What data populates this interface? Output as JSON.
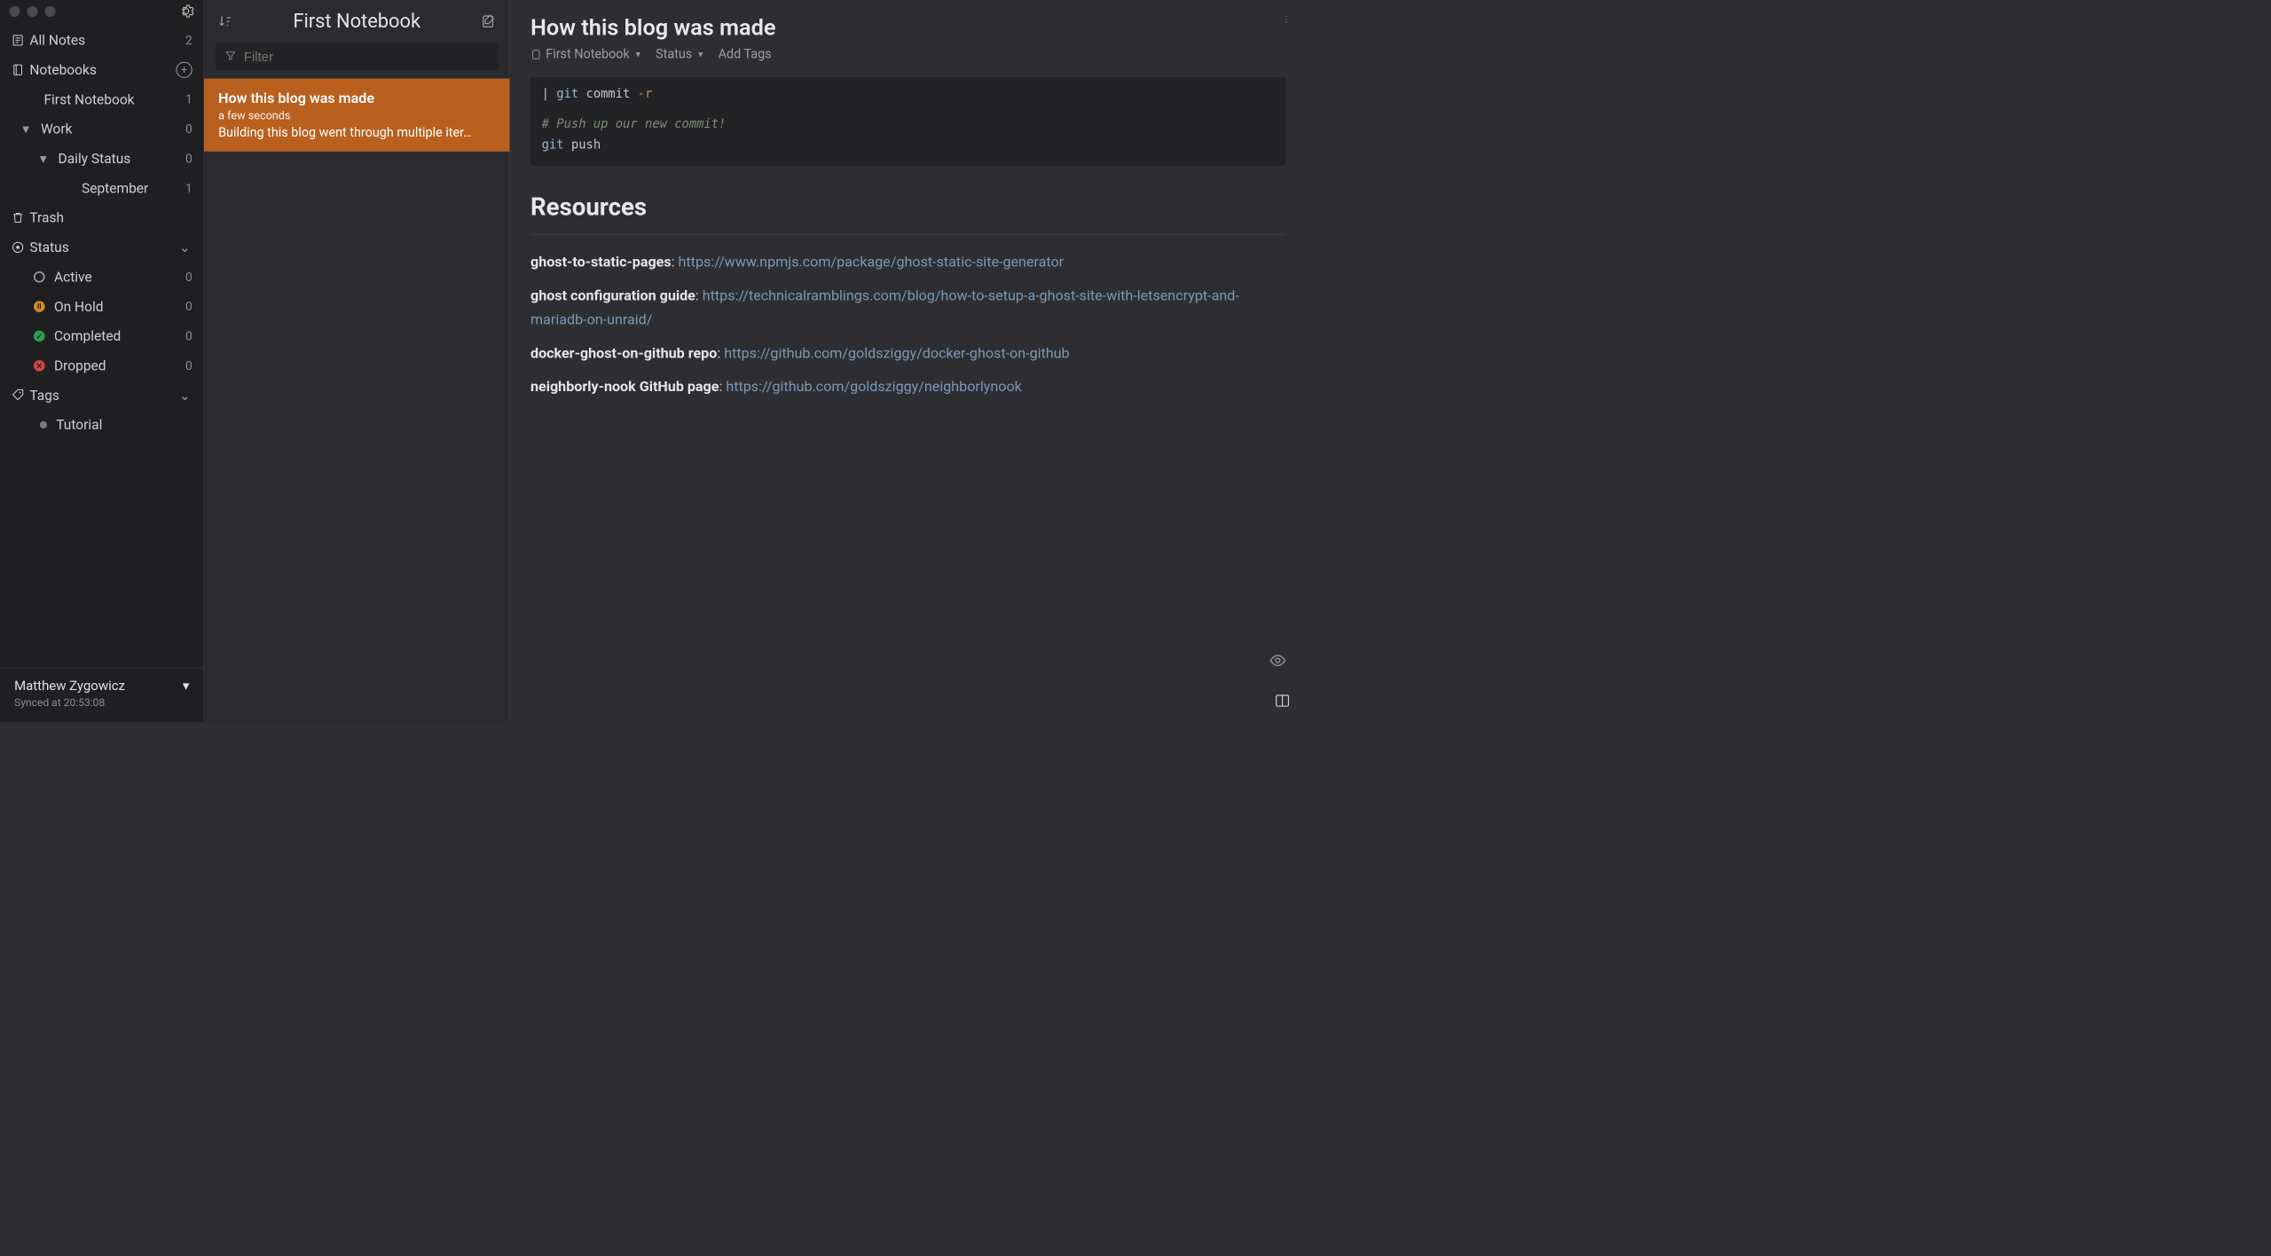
{
  "colors": {
    "accent": "#b9601f",
    "link": "#7a98b8",
    "bg": "#2e2e32"
  },
  "sidebar": {
    "all_notes": {
      "label": "All Notes",
      "count": "2"
    },
    "notebooks": {
      "label": "Notebooks"
    },
    "notebook_items": [
      {
        "label": "First Notebook",
        "count": "1"
      },
      {
        "label": "Work",
        "count": "0"
      },
      {
        "label": "Daily Status",
        "count": "0"
      },
      {
        "label": "September",
        "count": "1"
      }
    ],
    "trash": {
      "label": "Trash"
    },
    "status": {
      "label": "Status",
      "items": [
        {
          "label": "Active",
          "count": "0"
        },
        {
          "label": "On Hold",
          "count": "0"
        },
        {
          "label": "Completed",
          "count": "0"
        },
        {
          "label": "Dropped",
          "count": "0"
        }
      ]
    },
    "tags": {
      "label": "Tags",
      "items": [
        {
          "label": "Tutorial"
        }
      ]
    },
    "user": "Matthew Zygowicz",
    "synced": "Synced at 20:53:08"
  },
  "notelist": {
    "title": "First Notebook",
    "filter_placeholder": "Filter",
    "items": [
      {
        "title": "How this blog was made",
        "time": "a few seconds",
        "preview": "Building this blog went through multiple iter…"
      }
    ]
  },
  "editor": {
    "title": "How this blog was made",
    "notebook": "First Notebook",
    "status_label": "Status",
    "add_tags": "Add Tags",
    "code": {
      "line1a": "git",
      "line1b": " commit ",
      "line1c": "-r",
      "comment": "# Push up our new commit!",
      "line3a": "git",
      "line3b": " push"
    },
    "resources_heading": "Resources",
    "resources": [
      {
        "name": "ghost-to-static-pages",
        "sep": ": ",
        "url": "https://www.npmjs.com/package/ghost-static-site-generator"
      },
      {
        "name": "ghost configuration guide",
        "sep": ": ",
        "url": "https://technicalramblings.com/blog/how-to-setup-a-ghost-site-with-letsencrypt-and-mariadb-on-unraid/"
      },
      {
        "name": "docker-ghost-on-github repo",
        "sep": ": ",
        "url": "https://github.com/goldsziggy/docker-ghost-on-github"
      },
      {
        "name": "neighborly-nook GitHub page",
        "sep": ": ",
        "url": "https://github.com/goldsziggy/neighborlynook"
      }
    ]
  }
}
